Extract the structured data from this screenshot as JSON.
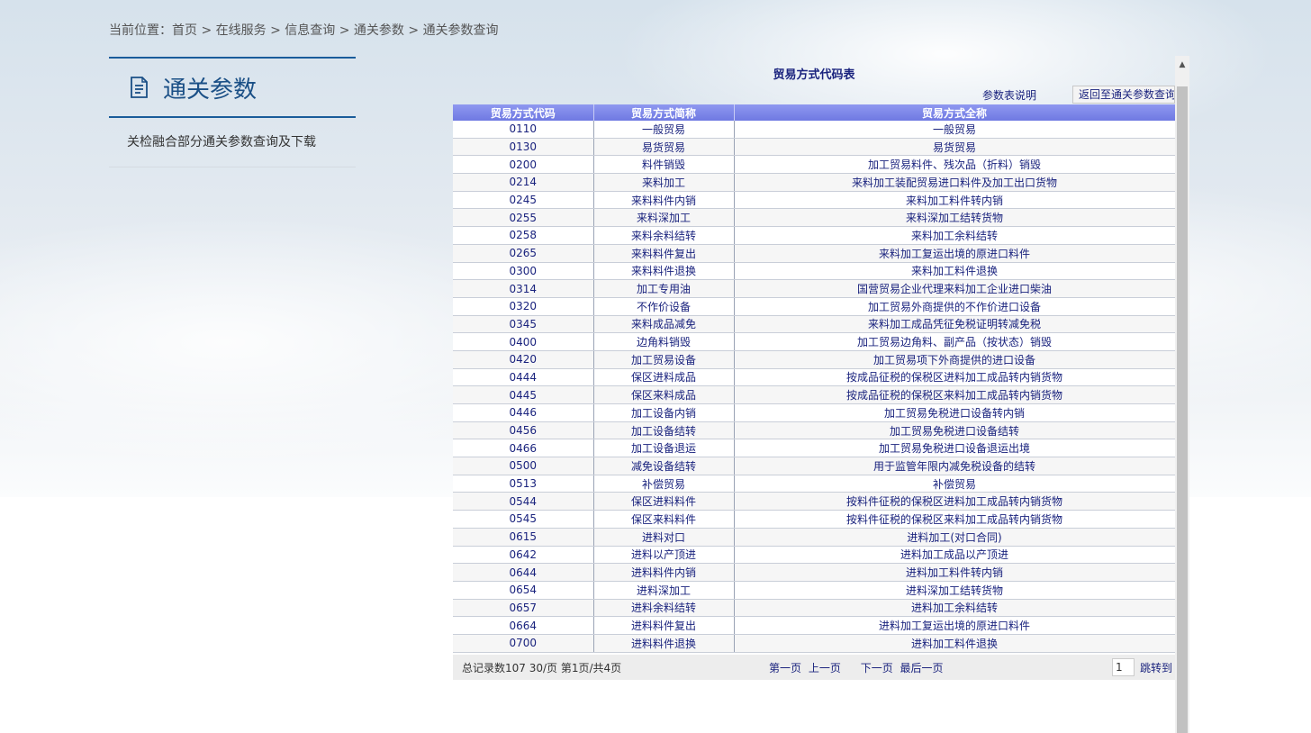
{
  "breadcrumb": {
    "prefix": "当前位置：",
    "items": [
      "首页",
      "在线服务",
      "信息查询",
      "通关参数",
      "通关参数查询"
    ],
    "separator": " > "
  },
  "sidebar": {
    "title": "通关参数",
    "icon": "document-icon",
    "items": [
      {
        "label": "关检融合部分通关参数查询及下载"
      }
    ]
  },
  "table_page": {
    "title": "贸易方式代码表",
    "explain_link": "参数表说明",
    "back_button": "返回至通关参数查询",
    "columns": [
      "贸易方式代码",
      "贸易方式简称",
      "贸易方式全称"
    ],
    "rows": [
      [
        "0110",
        "一般贸易",
        "一般贸易"
      ],
      [
        "0130",
        "易货贸易",
        "易货贸易"
      ],
      [
        "0200",
        "料件销毁",
        "加工贸易料件、残次品（折料）销毁"
      ],
      [
        "0214",
        "来料加工",
        "来料加工装配贸易进口料件及加工出口货物"
      ],
      [
        "0245",
        "来料料件内销",
        "来料加工料件转内销"
      ],
      [
        "0255",
        "来料深加工",
        "来料深加工结转货物"
      ],
      [
        "0258",
        "来料余料结转",
        "来料加工余料结转"
      ],
      [
        "0265",
        "来料料件复出",
        "来料加工复运出境的原进口料件"
      ],
      [
        "0300",
        "来料料件退换",
        "来料加工料件退换"
      ],
      [
        "0314",
        "加工专用油",
        "国营贸易企业代理来料加工企业进口柴油"
      ],
      [
        "0320",
        "不作价设备",
        "加工贸易外商提供的不作价进口设备"
      ],
      [
        "0345",
        "来料成品减免",
        "来料加工成品凭征免税证明转减免税"
      ],
      [
        "0400",
        "边角料销毁",
        "加工贸易边角料、副产品（按状态）销毁"
      ],
      [
        "0420",
        "加工贸易设备",
        "加工贸易项下外商提供的进口设备"
      ],
      [
        "0444",
        "保区进料成品",
        "按成品征税的保税区进料加工成品转内销货物"
      ],
      [
        "0445",
        "保区来料成品",
        "按成品征税的保税区来料加工成品转内销货物"
      ],
      [
        "0446",
        "加工设备内销",
        "加工贸易免税进口设备转内销"
      ],
      [
        "0456",
        "加工设备结转",
        "加工贸易免税进口设备结转"
      ],
      [
        "0466",
        "加工设备退运",
        "加工贸易免税进口设备退运出境"
      ],
      [
        "0500",
        "减免设备结转",
        "用于监管年限内减免税设备的结转"
      ],
      [
        "0513",
        "补偿贸易",
        "补偿贸易"
      ],
      [
        "0544",
        "保区进料料件",
        "按料件征税的保税区进料加工成品转内销货物"
      ],
      [
        "0545",
        "保区来料料件",
        "按料件征税的保税区来料加工成品转内销货物"
      ],
      [
        "0615",
        "进料对口",
        "进料加工(对口合同)"
      ],
      [
        "0642",
        "进料以产顶进",
        "进料加工成品以产顶进"
      ],
      [
        "0644",
        "进料料件内销",
        "进料加工料件转内销"
      ],
      [
        "0654",
        "进料深加工",
        "进料深加工结转货物"
      ],
      [
        "0657",
        "进料余料结转",
        "进料加工余料结转"
      ],
      [
        "0664",
        "进料料件复出",
        "进料加工复运出境的原进口料件"
      ],
      [
        "0700",
        "进料料件退换",
        "进料加工料件退换"
      ]
    ],
    "pager": {
      "summary": "总记录数107  30/页  第1页/共4页",
      "first": "第一页",
      "prev": "上一页",
      "next": "下一页",
      "last": "最后一页",
      "page_value": "1",
      "jump": "跳转到"
    }
  }
}
